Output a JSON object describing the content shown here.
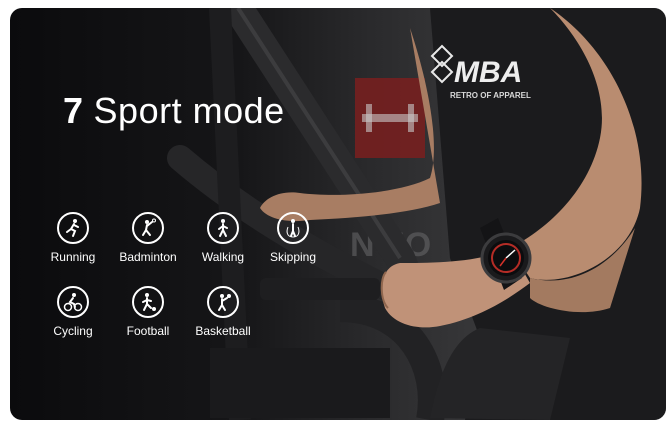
{
  "headline": {
    "number": "7",
    "text": "Sport mode"
  },
  "shirt_logo": {
    "main": "MBA",
    "sub": "RETRO OF APPAREL"
  },
  "background_sign": "NTIO",
  "modes": [
    {
      "id": "running",
      "label": "Running",
      "icon": "running-person-icon"
    },
    {
      "id": "badminton",
      "label": "Badminton",
      "icon": "badminton-player-icon"
    },
    {
      "id": "walking",
      "label": "Walking",
      "icon": "walking-person-icon"
    },
    {
      "id": "skipping",
      "label": "Skipping",
      "icon": "jump-rope-icon"
    },
    {
      "id": "cycling",
      "label": "Cycling",
      "icon": "cyclist-icon"
    },
    {
      "id": "football",
      "label": "Football",
      "icon": "football-player-icon"
    },
    {
      "id": "basketball",
      "label": "Basketball",
      "icon": "basketball-player-icon"
    }
  ],
  "colors": {
    "text": "#ffffff",
    "watch_accent": "#d4322a",
    "frame": "#2a2a2c"
  }
}
